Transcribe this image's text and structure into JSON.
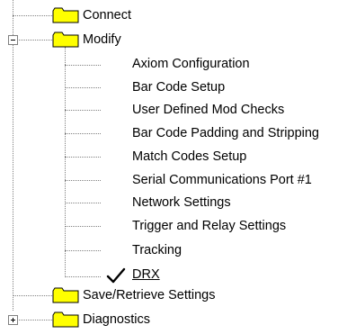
{
  "tree": {
    "nodes": [
      {
        "label": "Connect",
        "icon": "folder-icon",
        "expander": null
      },
      {
        "label": "Modify",
        "icon": "folder-icon",
        "expander": "collapse",
        "children": [
          {
            "label": "Axiom Configuration"
          },
          {
            "label": "Bar Code Setup"
          },
          {
            "label": "User Defined Mod Checks"
          },
          {
            "label": "Bar Code Padding and Stripping"
          },
          {
            "label": "Match Codes Setup"
          },
          {
            "label": "Serial Communications Port #1"
          },
          {
            "label": "Network Settings"
          },
          {
            "label": "Trigger and Relay Settings"
          },
          {
            "label": "Tracking"
          },
          {
            "label": "DRX",
            "icon": "checkmark-icon",
            "selected": true
          }
        ]
      },
      {
        "label": "Save/Retrieve Settings",
        "icon": "folder-icon",
        "expander": null
      },
      {
        "label": "Diagnostics",
        "icon": "folder-icon",
        "expander": "expand"
      }
    ]
  },
  "colors": {
    "folder_fill": "#ffff00",
    "folder_outline": "#000000",
    "tree_line": "#808080",
    "background": "#ffffff"
  }
}
